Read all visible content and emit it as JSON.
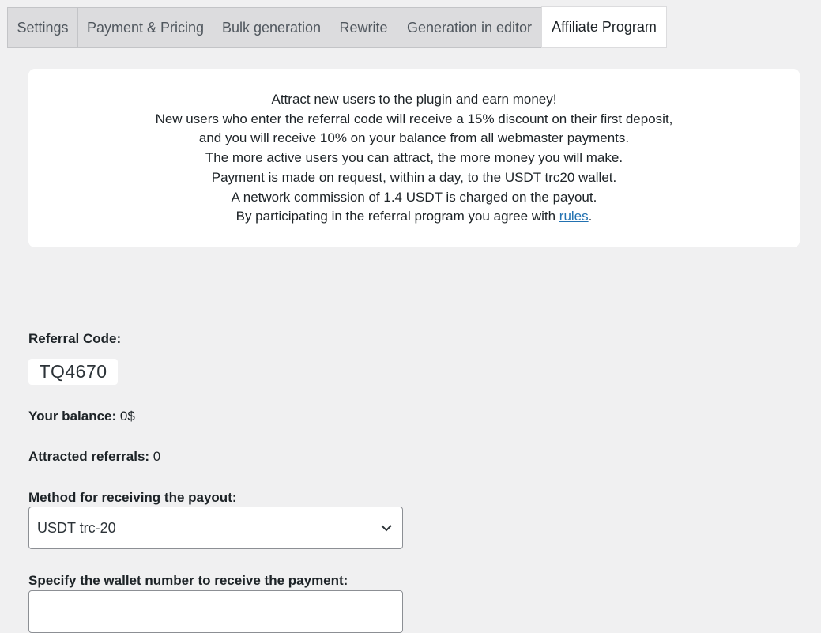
{
  "tabs": [
    {
      "label": "Settings",
      "active": false
    },
    {
      "label": "Payment & Pricing",
      "active": false
    },
    {
      "label": "Bulk generation",
      "active": false
    },
    {
      "label": "Rewrite",
      "active": false
    },
    {
      "label": "Generation in editor",
      "active": false
    },
    {
      "label": "Affiliate Program",
      "active": true
    }
  ],
  "notice": {
    "lines": [
      "Attract new users to the plugin and earn money!",
      "New users who enter the referral code will receive a 15% discount on their first deposit,",
      "and you will receive 10% on your balance from all webmaster payments.",
      "The more active users you can attract, the more money you will make.",
      "Payment is made on request, within a day, to the USDT trc20 wallet.",
      "A network commission of 1.4 USDT is charged on the payout."
    ],
    "rules_prefix": "By participating in the referral program you agree with ",
    "rules_link": "rules",
    "rules_suffix": "."
  },
  "referral": {
    "label": "Referral Code:",
    "code": "TQ4670"
  },
  "balance": {
    "label": "Your balance:",
    "value": "0$"
  },
  "referrals": {
    "label": "Attracted referrals:",
    "value": "0"
  },
  "payout_method": {
    "label": "Method for receiving the payout:",
    "selected": "USDT trc-20"
  },
  "wallet": {
    "label": "Specify the wallet number to receive the payment:",
    "value": ""
  },
  "colors": {
    "background": "#f0f0f1",
    "link": "#2271b1",
    "panel": "#ffffff"
  }
}
